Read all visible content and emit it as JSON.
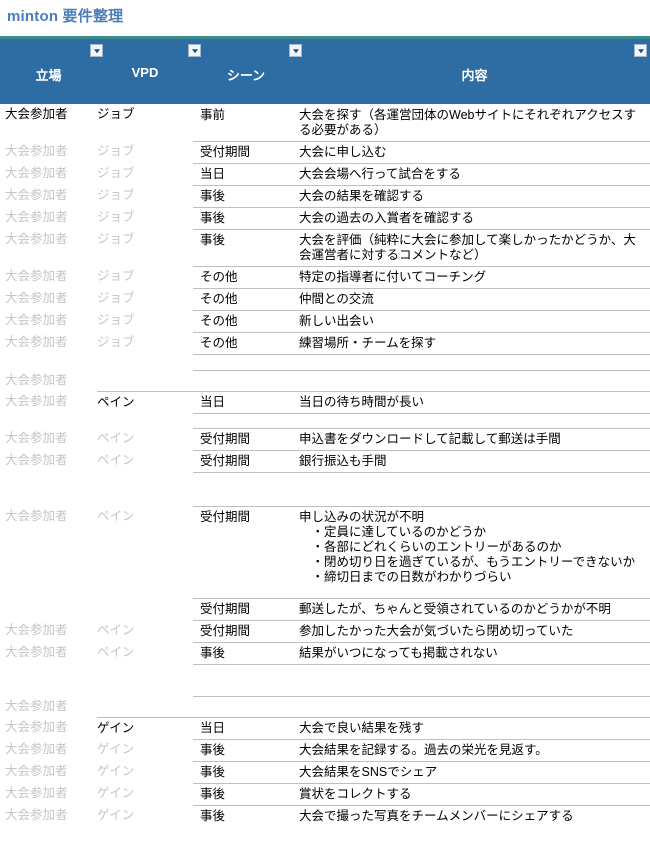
{
  "title": {
    "text": "minton 要件整理",
    "color": "#4a7ebb"
  },
  "colors": {
    "header_bg": "#2e6da4",
    "header_top_rule": "#3c8c8c",
    "faded_text": "#c6c6c6",
    "row_rule": "#bfbfbf"
  },
  "table": {
    "columns": [
      {
        "key": "stance",
        "label": "立場",
        "filter_icon": "filter-dropdown-icon"
      },
      {
        "key": "vpd",
        "label": "VPD",
        "filter_icon": "filter-dropdown-icon"
      },
      {
        "key": "scene",
        "label": "シーン",
        "filter_icon": "filter-dropdown-icon"
      },
      {
        "key": "content",
        "label": "内容",
        "filter_icon": "filter-dropdown-icon"
      }
    ],
    "rows": [
      {
        "stance": "大会参加者",
        "stance_faded": false,
        "vpd": "ジョブ",
        "vpd_faded": false,
        "scene": "事前",
        "content": "大会を探す（各運営団体のWebサイトにそれぞれアクセスする必要がある）",
        "rule": "none",
        "height": 37
      },
      {
        "stance": "大会参加者",
        "stance_faded": true,
        "vpd": "ジョブ",
        "vpd_faded": true,
        "scene": "受付期間",
        "content": "大会に申し込む",
        "rule": "scene",
        "height": 21
      },
      {
        "stance": "大会参加者",
        "stance_faded": true,
        "vpd": "ジョブ",
        "vpd_faded": true,
        "scene": "当日",
        "content": "大会会場へ行って試合をする",
        "rule": "scene",
        "height": 21
      },
      {
        "stance": "大会参加者",
        "stance_faded": true,
        "vpd": "ジョブ",
        "vpd_faded": true,
        "scene": "事後",
        "content": "大会の結果を確認する",
        "rule": "scene",
        "height": 21
      },
      {
        "stance": "大会参加者",
        "stance_faded": true,
        "vpd": "ジョブ",
        "vpd_faded": true,
        "scene": "事後",
        "content": "大会の過去の入賞者を確認する",
        "rule": "scene",
        "height": 21
      },
      {
        "stance": "大会参加者",
        "stance_faded": true,
        "vpd": "ジョブ",
        "vpd_faded": true,
        "scene": "事後",
        "content": "大会を評価（純粋に大会に参加して楽しかったかどうか、大会運営者に対するコメントなど）",
        "rule": "scene",
        "height": 37
      },
      {
        "stance": "大会参加者",
        "stance_faded": true,
        "vpd": "ジョブ",
        "vpd_faded": true,
        "scene": "その他",
        "content": "特定の指導者に付いてコーチング",
        "rule": "scene",
        "height": 21
      },
      {
        "stance": "大会参加者",
        "stance_faded": true,
        "vpd": "ジョブ",
        "vpd_faded": true,
        "scene": "その他",
        "content": "仲間との交流",
        "rule": "scene",
        "height": 21
      },
      {
        "stance": "大会参加者",
        "stance_faded": true,
        "vpd": "ジョブ",
        "vpd_faded": true,
        "scene": "その他",
        "content": "新しい出会い",
        "rule": "scene",
        "height": 21
      },
      {
        "stance": "大会参加者",
        "stance_faded": true,
        "vpd": "ジョブ",
        "vpd_faded": true,
        "scene": "その他",
        "content": "練習場所・チームを探す",
        "rule": "scene",
        "height": 21
      },
      {
        "stance": "",
        "stance_faded": true,
        "vpd": "",
        "vpd_faded": true,
        "scene": "",
        "content": "",
        "rule": "scene",
        "height": 16
      },
      {
        "stance": "大会参加者",
        "stance_faded": true,
        "vpd": "",
        "vpd_faded": true,
        "scene": "",
        "content": "",
        "rule": "scene",
        "height": 21
      },
      {
        "stance": "大会参加者",
        "stance_faded": true,
        "vpd": "ペイン",
        "vpd_faded": false,
        "scene": "当日",
        "content": "当日の待ち時間が長い",
        "rule": "vpd",
        "height": 21
      },
      {
        "stance": "",
        "stance_faded": true,
        "vpd": "",
        "vpd_faded": true,
        "scene": "",
        "content": "",
        "rule": "scene",
        "height": 15
      },
      {
        "stance": "大会参加者",
        "stance_faded": true,
        "vpd": "ペイン",
        "vpd_faded": true,
        "scene": "受付期間",
        "content": "申込書をダウンロードして記載して郵送は手間",
        "rule": "scene",
        "height": 21
      },
      {
        "stance": "大会参加者",
        "stance_faded": true,
        "vpd": "ペイン",
        "vpd_faded": true,
        "scene": "受付期間",
        "content": "銀行振込も手間",
        "rule": "scene",
        "height": 21
      },
      {
        "stance": "",
        "stance_faded": true,
        "vpd": "",
        "vpd_faded": true,
        "scene": "",
        "content": "",
        "rule": "scene",
        "height": 34
      },
      {
        "stance": "大会参加者",
        "stance_faded": true,
        "vpd": "ペイン",
        "vpd_faded": true,
        "scene": "受付期間",
        "content": "申し込みの状況が不明\n　・定員に達しているのかどうか\n　・各部にどれくらいのエントリーがあるのか\n　・閉め切り日を過ぎているが、もうエントリーできないか\n　・締切日までの日数がわかりづらい",
        "rule": "scene",
        "height": 92
      },
      {
        "stance": "",
        "stance_faded": true,
        "vpd": "",
        "vpd_faded": true,
        "scene": "受付期間",
        "content": "郵送したが、ちゃんと受領されているのかどうかが不明",
        "rule": "scene",
        "height": 21
      },
      {
        "stance": "大会参加者",
        "stance_faded": true,
        "vpd": "ペイン",
        "vpd_faded": true,
        "scene": "受付期間",
        "content": "参加したかった大会が気づいたら閉め切っていた",
        "rule": "scene",
        "height": 21
      },
      {
        "stance": "大会参加者",
        "stance_faded": true,
        "vpd": "ペイン",
        "vpd_faded": true,
        "scene": "事後",
        "content": "結果がいつになっても掲載されない",
        "rule": "scene",
        "height": 21
      },
      {
        "stance": "",
        "stance_faded": true,
        "vpd": "",
        "vpd_faded": true,
        "scene": "",
        "content": "",
        "rule": "scene",
        "height": 32
      },
      {
        "stance": "大会参加者",
        "stance_faded": true,
        "vpd": "",
        "vpd_faded": true,
        "scene": "",
        "content": "",
        "rule": "scene",
        "height": 21
      },
      {
        "stance": "大会参加者",
        "stance_faded": true,
        "vpd": "ゲイン",
        "vpd_faded": false,
        "scene": "当日",
        "content": "大会で良い結果を残す",
        "rule": "vpd",
        "height": 21
      },
      {
        "stance": "大会参加者",
        "stance_faded": true,
        "vpd": "ゲイン",
        "vpd_faded": true,
        "scene": "事後",
        "content": "大会結果を記録する。過去の栄光を見返す。",
        "rule": "scene",
        "height": 21
      },
      {
        "stance": "大会参加者",
        "stance_faded": true,
        "vpd": "ゲイン",
        "vpd_faded": true,
        "scene": "事後",
        "content": "大会結果をSNSでシェア",
        "rule": "scene",
        "height": 21
      },
      {
        "stance": "大会参加者",
        "stance_faded": true,
        "vpd": "ゲイン",
        "vpd_faded": true,
        "scene": "事後",
        "content": "賞状をコレクトする",
        "rule": "scene",
        "height": 21
      },
      {
        "stance": "大会参加者",
        "stance_faded": true,
        "vpd": "ゲイン",
        "vpd_faded": true,
        "scene": "事後",
        "content": "大会で撮った写真をチームメンバーにシェアする",
        "rule": "scene",
        "height": 21
      }
    ]
  }
}
